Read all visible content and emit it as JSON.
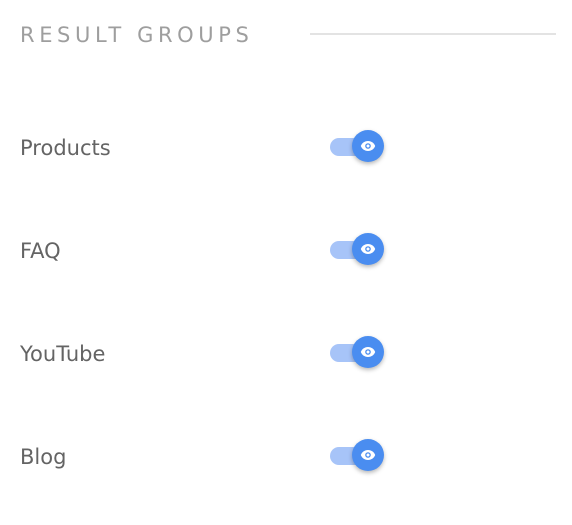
{
  "section": {
    "title": "RESULT GROUPS"
  },
  "groups": [
    {
      "label": "Products",
      "visible": true,
      "icon": "eye-icon"
    },
    {
      "label": "FAQ",
      "visible": true,
      "icon": "eye-icon"
    },
    {
      "label": "YouTube",
      "visible": true,
      "icon": "eye-icon"
    },
    {
      "label": "Blog",
      "visible": true,
      "icon": "eye-icon"
    }
  ],
  "colors": {
    "accent": "#4a8df0",
    "track": "#a7c4f8",
    "label": "#646464",
    "header": "#9e9e9e"
  }
}
